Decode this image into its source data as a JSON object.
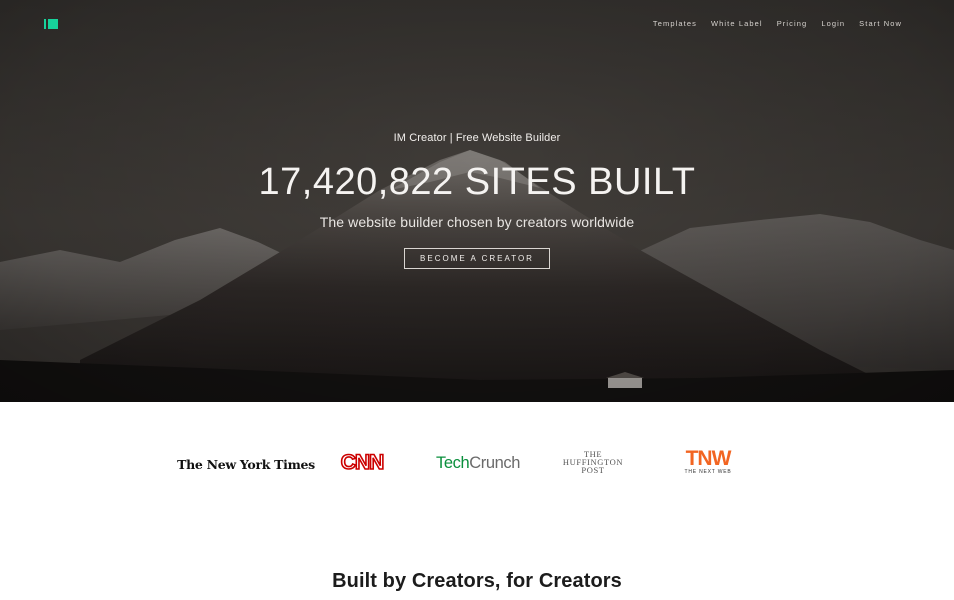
{
  "header": {
    "logo_icon": "imcreator-logo-icon",
    "brand_color": "#17d39b",
    "nav": [
      {
        "label": "Templates"
      },
      {
        "label": "White Label"
      },
      {
        "label": "Pricing"
      },
      {
        "label": "Login"
      },
      {
        "label": "Start Now"
      }
    ]
  },
  "hero": {
    "eyebrow": "IM Creator | Free Website Builder",
    "headline": "17,420,822 SITES BUILT",
    "subhead": "The website builder chosen by creators worldwide",
    "cta_label": "BECOME A CREATOR",
    "background": "dark snowy mountain landscape"
  },
  "press": {
    "nyt": "The New York Times",
    "cnn": "CNN",
    "techcrunch_tech": "Tech",
    "techcrunch_crunch": "Crunch",
    "huffington": [
      "THE",
      "HUFFINGTON",
      "POST"
    ],
    "tnw_big": "TNW",
    "tnw_small": "THE NEXT WEB",
    "colors": {
      "cnn": "#cc0000",
      "techcrunch": "#0a8f3c",
      "tnw": "#f26522"
    }
  },
  "section": {
    "title": "Built by Creators, for Creators"
  }
}
